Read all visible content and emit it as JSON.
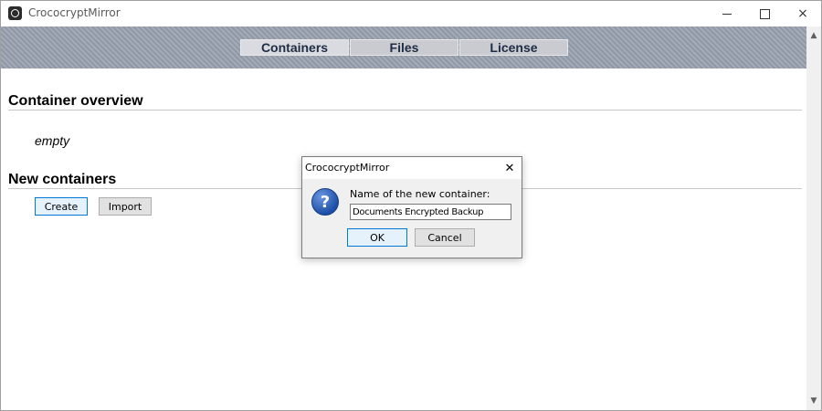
{
  "window": {
    "title": "CrococryptMirror",
    "icon": "app-icon",
    "controls": {
      "minimize": "minimize-icon",
      "maximize": "maximize-icon",
      "close": "×"
    }
  },
  "tabs": [
    {
      "label": "Containers",
      "active": true
    },
    {
      "label": "Files",
      "active": false
    },
    {
      "label": "License",
      "active": false
    }
  ],
  "main": {
    "overview_title": "Container overview",
    "empty_label": "empty",
    "new_title": "New containers",
    "create_button": "Create",
    "import_button": "Import"
  },
  "scrollbar": {
    "up": "▲",
    "down": "▼"
  },
  "dialog": {
    "title": "CrococryptMirror",
    "close": "✕",
    "icon": "question-icon",
    "icon_glyph": "?",
    "prompt": "Name of the new container:",
    "input_value": "Documents Encrypted Backup",
    "ok": "OK",
    "cancel": "Cancel"
  }
}
